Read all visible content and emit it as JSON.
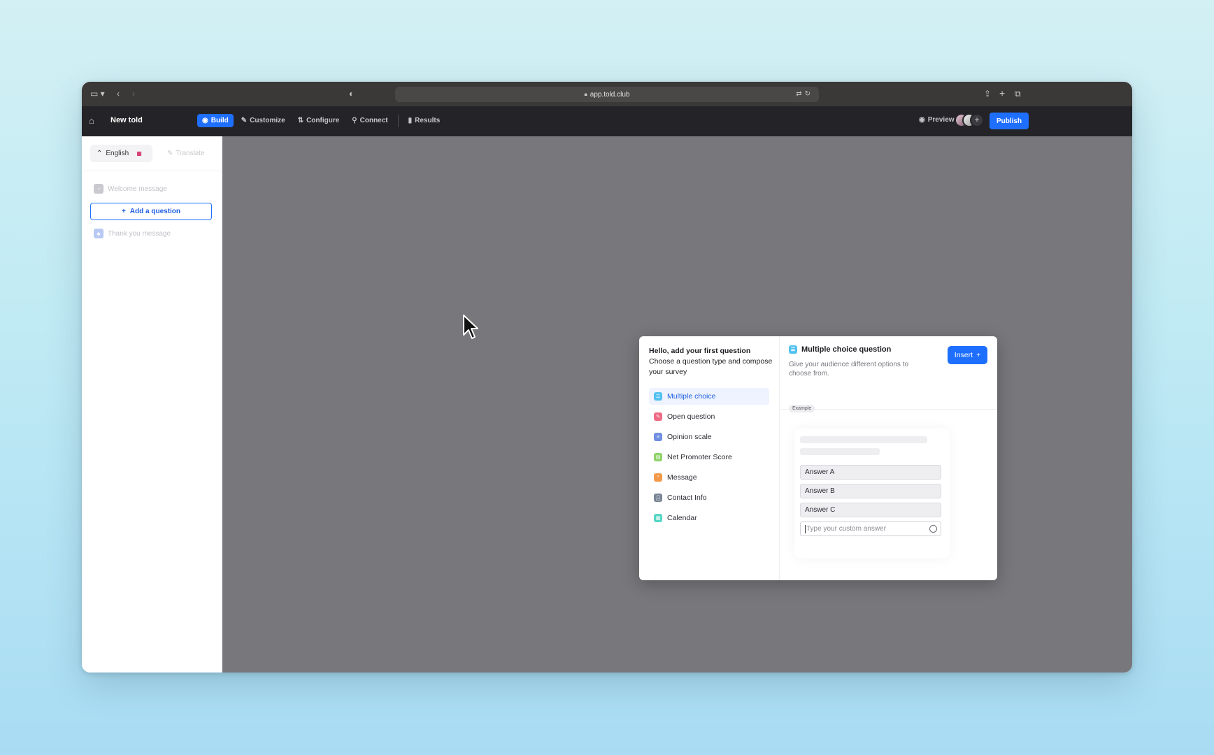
{
  "browser": {
    "url": "app.told.club"
  },
  "header": {
    "title": "New told",
    "tabs": [
      {
        "label": "Build",
        "active": true,
        "icon": "build-icon"
      },
      {
        "label": "Customize",
        "active": false,
        "icon": "brush-icon"
      },
      {
        "label": "Configure",
        "active": false,
        "icon": "sliders-icon"
      },
      {
        "label": "Connect",
        "active": false,
        "icon": "plug-icon"
      },
      {
        "label": "Results",
        "active": false,
        "icon": "bar-chart-icon"
      }
    ],
    "preview_label": "Preview",
    "publish_label": "Publish"
  },
  "sidebar": {
    "language": "English",
    "translate_label": "Translate",
    "welcome": "Welcome message",
    "add_question": "Add a question",
    "thank_you": "Thank you message"
  },
  "modal": {
    "heading_line1": "Hello, add your first question",
    "heading_line2": "Choose a question type and compose your survey",
    "types": [
      {
        "label": "Multiple choice",
        "color": "#52c1f0"
      },
      {
        "label": "Open question",
        "color": "#ef6b84"
      },
      {
        "label": "Opinion scale",
        "color": "#6f8fe0"
      },
      {
        "label": "Net Promoter Score",
        "color": "#8fd36a"
      },
      {
        "label": "Message",
        "color": "#f29a4a"
      },
      {
        "label": "Contact Info",
        "color": "#7a8596"
      },
      {
        "label": "Calendar",
        "color": "#56d6c4"
      }
    ],
    "detail_title": "Multiple choice question",
    "detail_desc": "Give your audience different options to choose from.",
    "insert_label": "Insert",
    "example_label": "Example",
    "answers": [
      "Answer A",
      "Answer B",
      "Answer C"
    ],
    "custom_placeholder": "Type your custom answer"
  },
  "colors": {
    "accent": "#1f6fff",
    "header_bg": "#242428",
    "canvas_bg": "#77777c"
  }
}
